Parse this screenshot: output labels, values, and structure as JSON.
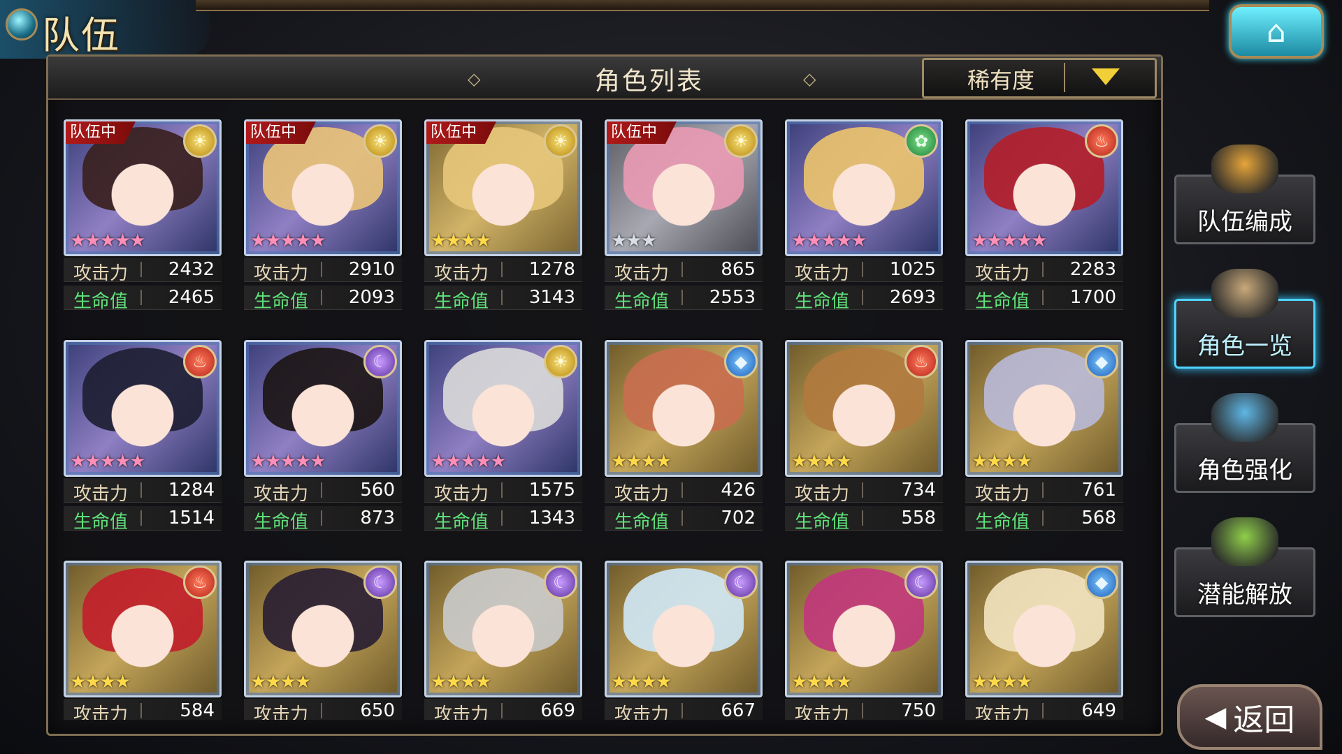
{
  "header": {
    "title": "队伍",
    "home_icon": "home-icon"
  },
  "panel": {
    "title": "角色列表",
    "sort_label": "稀有度"
  },
  "labels": {
    "attack": "攻击力",
    "hp": "生命值",
    "in_party": "队伍中"
  },
  "characters": [
    {
      "in_party": true,
      "element": "sun",
      "stars": "★★★★★",
      "attack": "2432",
      "hp": "2465",
      "hair": "#3a2120"
    },
    {
      "in_party": true,
      "element": "sun",
      "stars": "★★★★★",
      "attack": "2910",
      "hp": "2093",
      "hair": "#e8c27a"
    },
    {
      "in_party": true,
      "element": "sun",
      "stars": "★★★★",
      "attack": "1278",
      "hp": "3143",
      "hair": "#e5c67a"
    },
    {
      "in_party": true,
      "element": "sun",
      "stars": "★★★",
      "attack": "865",
      "hp": "2553",
      "hair": "#e79ab2"
    },
    {
      "in_party": false,
      "element": "wind",
      "stars": "★★★★★",
      "attack": "1025",
      "hp": "2693",
      "hair": "#e9c26c"
    },
    {
      "in_party": false,
      "element": "fire",
      "stars": "★★★★★",
      "attack": "2283",
      "hp": "1700",
      "hair": "#b2202a"
    },
    {
      "in_party": false,
      "element": "fire",
      "stars": "★★★★★",
      "attack": "1284",
      "hp": "1514",
      "hair": "#1e1f34"
    },
    {
      "in_party": false,
      "element": "moon",
      "stars": "★★★★★",
      "attack": "560",
      "hp": "873",
      "hair": "#1c1616"
    },
    {
      "in_party": false,
      "element": "sun",
      "stars": "★★★★★",
      "attack": "1575",
      "hp": "1343",
      "hair": "#d8d8d8"
    },
    {
      "in_party": false,
      "element": "water",
      "stars": "★★★★",
      "attack": "426",
      "hp": "702",
      "hair": "#c86e4e"
    },
    {
      "in_party": false,
      "element": "fire",
      "stars": "★★★★",
      "attack": "734",
      "hp": "558",
      "hair": "#b07a3e"
    },
    {
      "in_party": false,
      "element": "water",
      "stars": "★★★★",
      "attack": "761",
      "hp": "568",
      "hair": "#b8b8d6"
    },
    {
      "in_party": false,
      "element": "fire",
      "stars": "★★★★",
      "attack": "584",
      "hp": "",
      "hair": "#c1202a"
    },
    {
      "in_party": false,
      "element": "moon",
      "stars": "★★★★",
      "attack": "650",
      "hp": "",
      "hair": "#2a1f33"
    },
    {
      "in_party": false,
      "element": "moon",
      "stars": "★★★★",
      "attack": "669",
      "hp": "",
      "hair": "#c9c9c9"
    },
    {
      "in_party": false,
      "element": "moon",
      "stars": "★★★★",
      "attack": "667",
      "hp": "",
      "hair": "#cfe6f3"
    },
    {
      "in_party": false,
      "element": "moon",
      "stars": "★★★★",
      "attack": "750",
      "hp": "",
      "hair": "#c0387b"
    },
    {
      "in_party": false,
      "element": "water",
      "stars": "★★★★",
      "attack": "649",
      "hp": "",
      "hair": "#f0e2be"
    }
  ],
  "side_menu": [
    {
      "label": "队伍编成",
      "active": false,
      "icon": "party-icon"
    },
    {
      "label": "角色一览",
      "active": true,
      "icon": "book-icon"
    },
    {
      "label": "角色强化",
      "active": false,
      "icon": "crystal-icon"
    },
    {
      "label": "潜能解放",
      "active": false,
      "icon": "orb-icon"
    }
  ],
  "back": {
    "label": "返回",
    "icon": "back-arrow-icon"
  },
  "colors": {
    "hp_label": "#5fe27a",
    "attack_label": "#e6d7b8",
    "badge": "#b11a1a",
    "sort_arrow": "#f2cf39",
    "active_border": "#4fd4ff"
  }
}
